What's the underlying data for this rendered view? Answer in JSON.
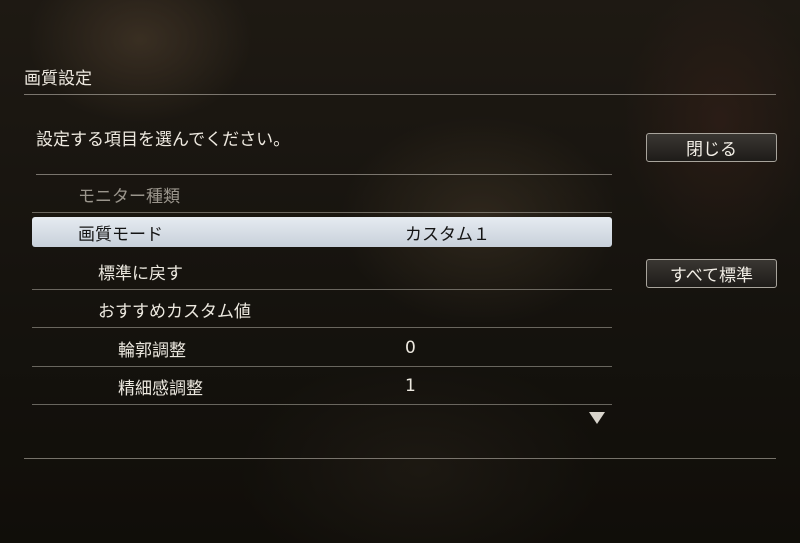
{
  "header": {
    "title": "画質設定"
  },
  "main": {
    "instruction": "設定する項目を選んでください。",
    "close_button": "閉じる",
    "reset_all_button": "すべて標準",
    "menu": [
      {
        "label": "モニター種類",
        "value": ""
      },
      {
        "label": "画質モード",
        "value": "カスタム１"
      },
      {
        "label": "標準に戻す",
        "value": ""
      },
      {
        "label": "おすすめカスタム値",
        "value": ""
      },
      {
        "label": "輪郭調整",
        "value": "0"
      },
      {
        "label": "精細感調整",
        "value": "1"
      }
    ],
    "scroll_indicator": "down-triangle-icon"
  }
}
